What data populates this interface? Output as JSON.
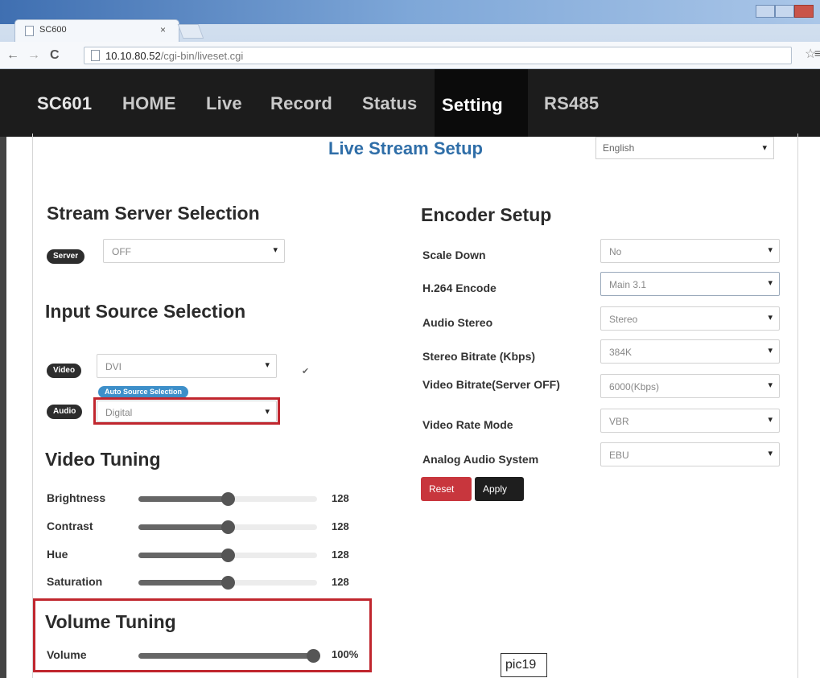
{
  "browser": {
    "tab_title": "SC600",
    "tab_close": "×",
    "url_host": "10.10.80.52",
    "url_path": "/cgi-bin/liveset.cgi",
    "back_icon": "←",
    "forward_icon": "→",
    "reload_icon": "C",
    "star_icon": "☆",
    "menu_icon": "≡"
  },
  "site_nav": {
    "brand": "SC601",
    "items": [
      "HOME",
      "Live",
      "Record",
      "Status",
      "Setting",
      "RS485"
    ]
  },
  "page": {
    "title": "Live Stream Setup",
    "language": "English",
    "caret": "▾"
  },
  "stream_server": {
    "heading": "Stream Server Selection",
    "server_pill": "Server",
    "server_value": "OFF"
  },
  "input_source": {
    "heading": "Input Source Selection",
    "video_pill": "Video",
    "video_value": "DVI",
    "checkbox_mark": "✔",
    "auto_source_pill": "Auto Source Selection",
    "audio_pill": "Audio",
    "audio_value": "Digital"
  },
  "video_tuning": {
    "heading": "Video Tuning",
    "sliders": [
      {
        "label": "Brightness",
        "value_text": "128",
        "fraction": 0.5
      },
      {
        "label": "Contrast",
        "value_text": "128",
        "fraction": 0.5
      },
      {
        "label": "Hue",
        "value_text": "128",
        "fraction": 0.5
      },
      {
        "label": "Saturation",
        "value_text": "128",
        "fraction": 0.5
      }
    ]
  },
  "volume_tuning": {
    "heading": "Volume Tuning",
    "label": "Volume",
    "value_text": "100%",
    "fraction": 1.0
  },
  "encoder": {
    "heading": "Encoder Setup",
    "rows": [
      {
        "label": "Scale Down",
        "value": "No"
      },
      {
        "label": "H.264 Encode",
        "value": "Main 3.1"
      },
      {
        "label": "Audio Stereo",
        "value": "Stereo"
      },
      {
        "label": "Stereo Bitrate (Kbps)",
        "value": "384K"
      },
      {
        "label": "Video Bitrate(Server OFF)",
        "value": "6000(Kbps)"
      },
      {
        "label": "Video Rate Mode",
        "value": "VBR"
      },
      {
        "label": "Analog Audio System",
        "value": "EBU"
      }
    ],
    "reset_label": "Reset",
    "apply_label": "Apply"
  },
  "caption": "pic19",
  "colors": {
    "nav_bg": "#1c1c1c",
    "title_blue": "#2f6ea8",
    "reset_red": "#c8363d",
    "highlight_red": "#c0262e",
    "auto_pill_blue": "#3d8fc9"
  }
}
